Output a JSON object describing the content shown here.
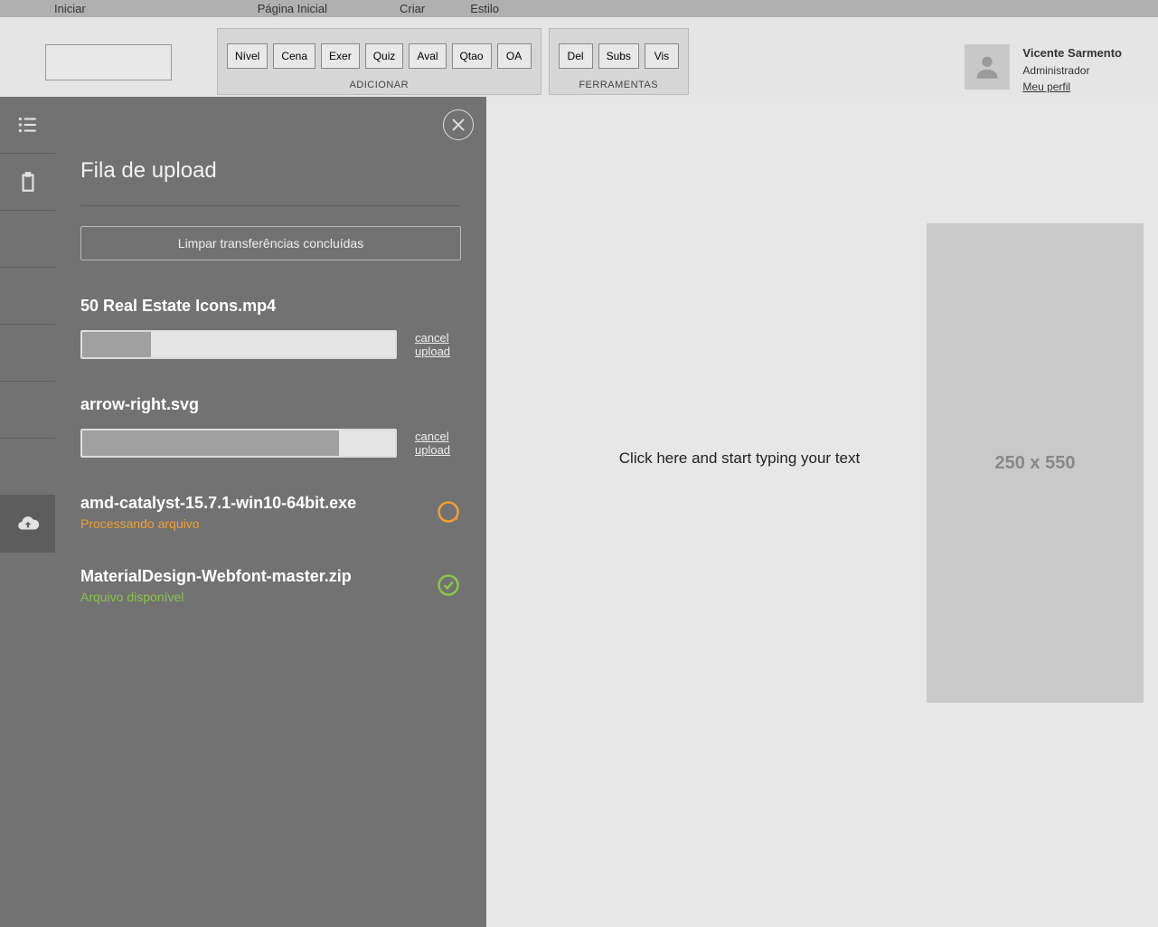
{
  "topnav": {
    "items": [
      "Iniciar",
      "Página Inicial",
      "Criar",
      "Estilo"
    ]
  },
  "ribbon": {
    "add_group": {
      "label": "ADICIONAR",
      "buttons": [
        "Nível",
        "Cena",
        "Exer",
        "Quiz",
        "Aval",
        "Qtao",
        "OA"
      ]
    },
    "tools_group": {
      "label": "FERRAMENTAS",
      "buttons": [
        "Del",
        "Subs",
        "Vis"
      ]
    }
  },
  "user": {
    "name": "Vicente Sarmento",
    "role": "Administrador",
    "profile_link": "Meu perfil"
  },
  "panel": {
    "title": "Fila de upload",
    "clear_label": "Limpar transferências concluídas",
    "items": [
      {
        "filename": "50 Real Estate Icons.mp4",
        "progress": 22,
        "cancel": "cancel upload",
        "state": "uploading"
      },
      {
        "filename": "arrow-right.svg",
        "progress": 82,
        "cancel": "cancel upload",
        "state": "uploading"
      },
      {
        "filename": "amd-catalyst-15.7.1-win10-64bit.exe",
        "status": "Processando arquivo",
        "state": "processing"
      },
      {
        "filename": "MaterialDesign-Webfont-master.zip",
        "status": "Arquivo disponível",
        "state": "done"
      }
    ]
  },
  "content": {
    "placeholder_text": "Click here and start typing your text",
    "image_placeholder": "250 x 550"
  }
}
